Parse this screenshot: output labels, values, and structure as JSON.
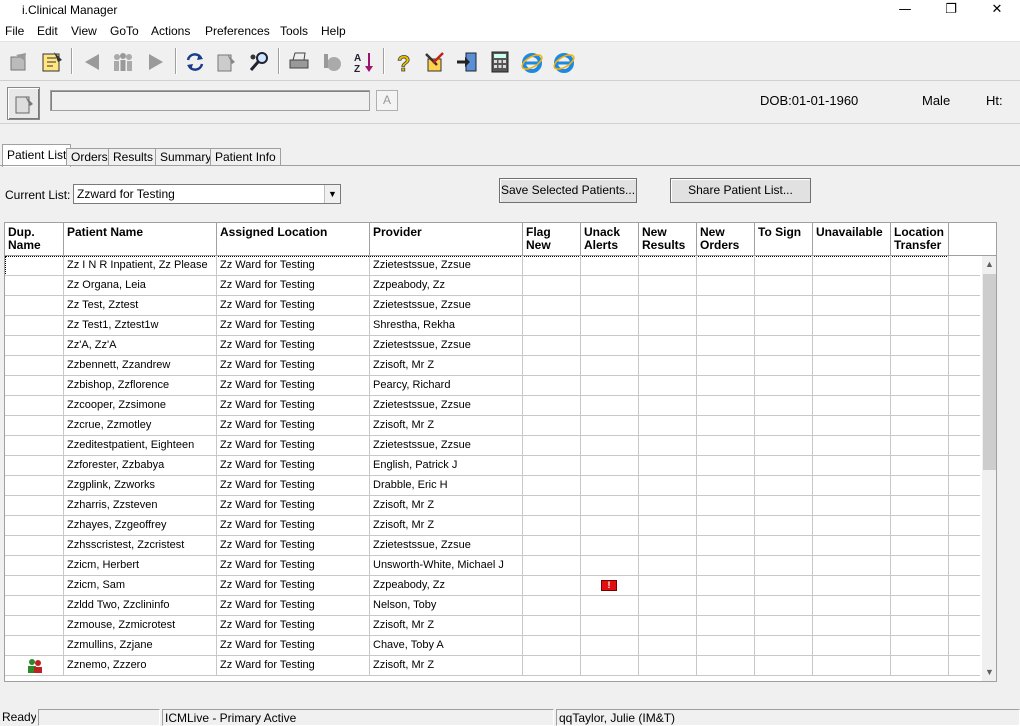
{
  "window": {
    "title": "i.Clinical Manager",
    "minimize": "—",
    "maximize": "❐",
    "close": "✕"
  },
  "menu": [
    "File",
    "Edit",
    "View",
    "GoTo",
    "Actions",
    "Preferences",
    "Tools",
    "Help"
  ],
  "patient_bar": {
    "dob": "DOB:01-01-1960",
    "gender": "Male",
    "height_label": "Ht:",
    "a_button": "A"
  },
  "tabs": [
    "Patient List",
    "Orders",
    "Results",
    "Summary",
    "Patient Info"
  ],
  "current_list": {
    "label": "Current List:",
    "value": "Zzward for Testing"
  },
  "buttons": {
    "save_selected": "Save Selected Patients...",
    "share_list": "Share Patient List..."
  },
  "columns": [
    "Dup.\nName",
    "Patient Name",
    "Assigned Location",
    "Provider",
    "Flag\nNew",
    "Unack\nAlerts",
    "New\nResults",
    "New\nOrders",
    "To Sign",
    "Unavailable",
    "Location\nTransfer"
  ],
  "rows": [
    {
      "name": "Zz I N R Inpatient, Zz Please",
      "location": "Zz Ward for Testing",
      "provider": "Zzietestssue, Zzsue"
    },
    {
      "name": "Zz Organa, Leia",
      "location": "Zz Ward for Testing",
      "provider": "Zzpeabody, Zz"
    },
    {
      "name": "Zz Test, Zztest",
      "location": "Zz Ward for Testing",
      "provider": "Zzietestssue, Zzsue"
    },
    {
      "name": "Zz Test1, Zztest1w",
      "location": "Zz Ward for Testing",
      "provider": "Shrestha, Rekha"
    },
    {
      "name": "Zz'A, Zz'A",
      "location": "Zz Ward for Testing",
      "provider": "Zzietestssue, Zzsue"
    },
    {
      "name": "Zzbennett, Zzandrew",
      "location": "Zz Ward for Testing",
      "provider": "Zzisoft, Mr Z"
    },
    {
      "name": "Zzbishop, Zzflorence",
      "location": "Zz Ward for Testing",
      "provider": "Pearcy, Richard"
    },
    {
      "name": "Zzcooper, Zzsimone",
      "location": "Zz Ward for Testing",
      "provider": "Zzietestssue, Zzsue"
    },
    {
      "name": "Zzcrue, Zzmotley",
      "location": "Zz Ward for Testing",
      "provider": "Zzisoft, Mr Z"
    },
    {
      "name": "Zzeditestpatient, Eighteen",
      "location": "Zz Ward for Testing",
      "provider": "Zzietestssue, Zzsue"
    },
    {
      "name": "Zzforester, Zzbabya",
      "location": "Zz Ward for Testing",
      "provider": "English, Patrick J"
    },
    {
      "name": "Zzgplink, Zzworks",
      "location": "Zz Ward for Testing",
      "provider": "Drabble, Eric H"
    },
    {
      "name": "Zzharris, Zzsteven",
      "location": "Zz Ward for Testing",
      "provider": "Zzisoft, Mr Z"
    },
    {
      "name": "Zzhayes, Zzgeoffrey",
      "location": "Zz Ward for Testing",
      "provider": "Zzisoft, Mr Z"
    },
    {
      "name": "Zzhsscristest, Zzcristest",
      "location": "Zz Ward for Testing",
      "provider": "Zzietestssue, Zzsue"
    },
    {
      "name": "Zzicm, Herbert",
      "location": "Zz Ward for Testing",
      "provider": "Unsworth-White, Michael J"
    },
    {
      "name": "Zzicm, Sam",
      "location": "Zz Ward for Testing",
      "provider": "Zzpeabody, Zz",
      "unack_alert": true
    },
    {
      "name": "Zzldd Two, Zzclininfo",
      "location": "Zz Ward for Testing",
      "provider": "Nelson, Toby"
    },
    {
      "name": "Zzmouse, Zzmicrotest",
      "location": "Zz Ward for Testing",
      "provider": "Zzisoft, Mr Z"
    },
    {
      "name": "Zzmullins, Zzjane",
      "location": "Zz Ward for Testing",
      "provider": "Chave, Toby A"
    },
    {
      "name": "Zznemo, Zzzero",
      "location": "Zz Ward for Testing",
      "provider": "Zzisoft, Mr Z",
      "dup_name": true
    }
  ],
  "status_bar": {
    "ready": "Ready",
    "env": "ICMLive - Primary Active",
    "user": "qqTaylor, Julie (IM&T)"
  }
}
